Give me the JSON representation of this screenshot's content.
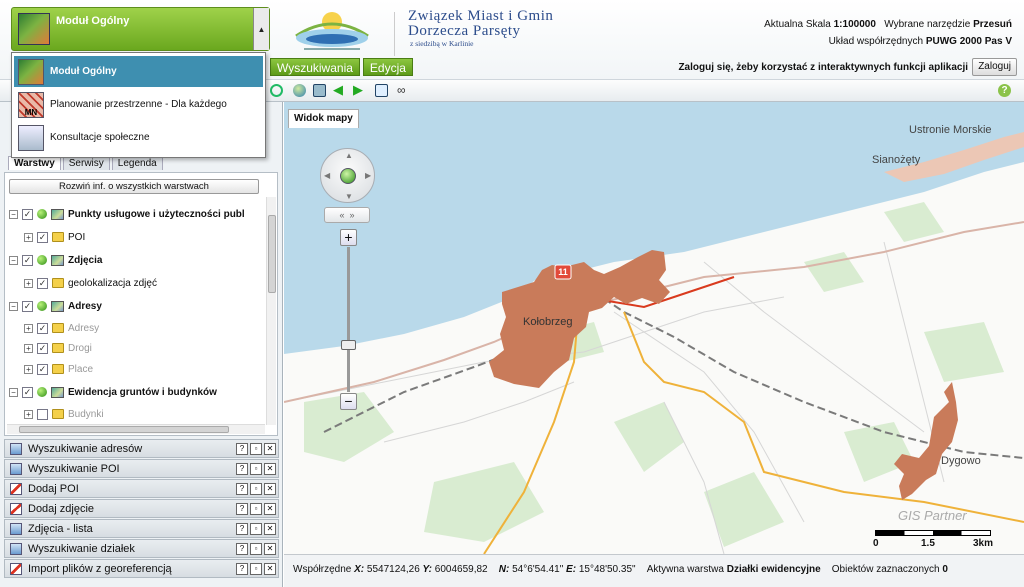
{
  "module": {
    "selected_label": "Moduł Ogólny",
    "options": [
      "Moduł Ogólny",
      "Planowanie przestrzenne - Dla każdego",
      "Konsultacje społeczne"
    ]
  },
  "logo": {
    "title_line1": "Związek Miast i Gmin",
    "title_line2": "Dorzecza Parsęty",
    "subtitle": "z siedzibą w Karlinie"
  },
  "info": {
    "scale_label": "Aktualna Skala",
    "scale_value": "1:100000",
    "tool_label": "Wybrane narzędzie",
    "tool_value": "Przesuń",
    "coords_label": "Układ współrzędnych",
    "coords_value": "PUWG 2000 Pas V",
    "login_hint": "Zaloguj się, żeby korzystać z interaktywnych funkcji aplikacji",
    "login_button": "Zaloguj"
  },
  "menu": {
    "items": [
      "Wyszukiwania",
      "Edycja"
    ]
  },
  "toolbar": {
    "icons": [
      "zoom-out-icon",
      "globe-icon",
      "zoom-extent-icon",
      "back-arrow-icon",
      "forward-arrow-icon",
      "window-icon",
      "measure-icon",
      "help-icon"
    ]
  },
  "panel": {
    "tabs": [
      "Warstwy",
      "Serwisy",
      "Legenda"
    ],
    "expand_all": "Rozwiń inf. o wszystkich warstwach",
    "tree": [
      {
        "label": "Punkty usługowe i użyteczności publ",
        "level": 0,
        "checked": true
      },
      {
        "label": "POI",
        "level": 1,
        "checked": true
      },
      {
        "label": "Zdjęcia",
        "level": 0,
        "checked": true
      },
      {
        "label": "geolokalizacja zdjęć",
        "level": 1,
        "checked": true
      },
      {
        "label": "Adresy",
        "level": 0,
        "checked": true
      },
      {
        "label": "Adresy",
        "level": 1,
        "checked": true
      },
      {
        "label": "Drogi",
        "level": 1,
        "checked": true
      },
      {
        "label": "Place",
        "level": 1,
        "checked": true
      },
      {
        "label": "Ewidencja gruntów i budynków",
        "level": 0,
        "checked": true
      },
      {
        "label": "Budynki",
        "level": 1,
        "checked": false
      }
    ],
    "tools": [
      "Wyszukiwanie adresów",
      "Wyszukiwanie POI",
      "Dodaj POI",
      "Dodaj zdjęcie",
      "Zdjęcia - lista",
      "Wyszukiwanie działek",
      "Import plików z georeferencją"
    ]
  },
  "map": {
    "tab_label": "Widok mapy",
    "places": [
      "Ustronie Morskie",
      "Sianożęty",
      "Kołobrzeg",
      "Dygowo"
    ],
    "road_badge": "11",
    "scale_ticks": [
      "0",
      "1.5",
      "3km"
    ],
    "watermark": "GIS Partner"
  },
  "status": {
    "coords_label": "Współrzędne",
    "x_label": "X:",
    "x_value": "5547124,26",
    "y_label": "Y:",
    "y_value": "6004659,82",
    "n_label": "N:",
    "n_value": "54°6'54.41\"",
    "e_label": "E:",
    "e_value": "15°48'50.35\"",
    "active_layer_label": "Aktywna warstwa",
    "active_layer_value": "Działki ewidencyjne",
    "selected_label": "Obiektów zaznaczonych",
    "selected_value": "0"
  },
  "colors": {
    "green_accent": "#6aa81e",
    "selected_blue": "#3e8fb0",
    "sea": "#b9d9ea",
    "town": "#c97b5a"
  }
}
